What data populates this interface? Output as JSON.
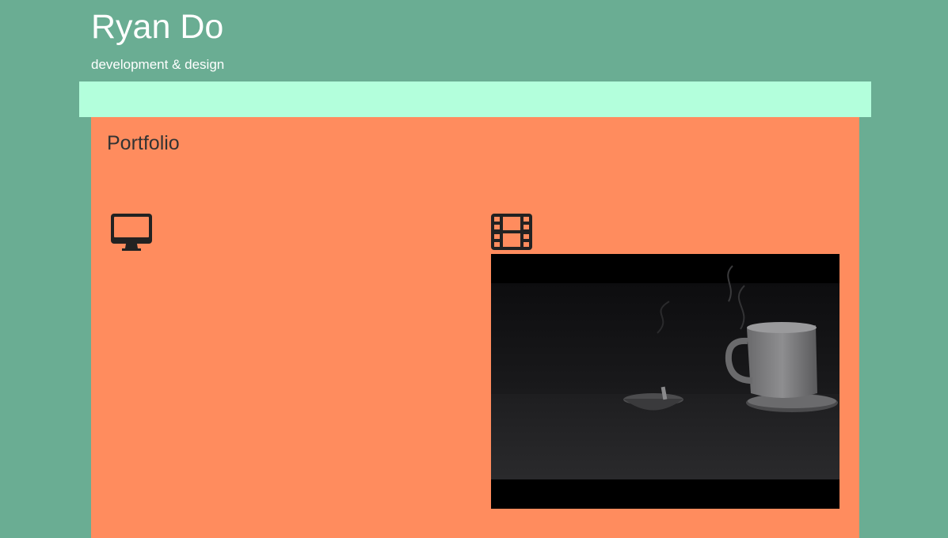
{
  "header": {
    "title": "Ryan Do",
    "tagline": "development & design"
  },
  "nav": {
    "items": []
  },
  "portfolio": {
    "heading": "Portfolio",
    "columns": [
      {
        "icon": "desktop-icon"
      },
      {
        "icon": "film-icon"
      }
    ]
  },
  "colors": {
    "page_background": "#6aad93",
    "nav_background": "#b3ffdc",
    "panel_background": "#ff8c5e",
    "heading_text": "#333333",
    "icon_color": "#222222"
  }
}
